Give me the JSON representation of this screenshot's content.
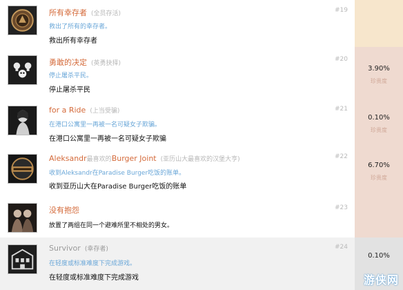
{
  "achievements": [
    {
      "icon": "survivor-medal-icon",
      "title": "所有幸存者",
      "tag": "(全员存活)",
      "desc_en": "救出了所有的幸存者。",
      "desc_cn": "救出所有幸存者",
      "number": "#19",
      "percent": "",
      "difficulty": ""
    },
    {
      "icon": "skulls-icon",
      "title": "勇敢的决定",
      "tag": "(英勇抉择)",
      "desc_en": "停止屠杀平民。",
      "desc_cn": "停止屠杀平民",
      "number": "#20",
      "percent": "3.90%",
      "difficulty": "珍贵度"
    },
    {
      "icon": "woman-portrait-icon",
      "title": "for a Ride",
      "tag": "(上当受骗)",
      "desc_en": "在港口公寓里一再被一名可疑女子欺骗。",
      "desc_cn": "在港口公寓里一再被一名可疑女子欺骗",
      "number": "#21",
      "percent": "0.10%",
      "difficulty": "珍贵度"
    },
    {
      "icon": "burger-joint-badge-icon",
      "title_parts": [
        "Aleksandr",
        "最喜欢的",
        "Burger Joint"
      ],
      "tag": "(亚历山大最喜欢的汉堡大亨)",
      "desc_en": "收到Aleksandr在Paradise Burger吃饭的账单。",
      "desc_cn": "收到亚历山大在Paradise Burger吃饭的账单",
      "number": "#22",
      "percent": "6.70%",
      "difficulty": "珍贵度"
    },
    {
      "icon": "couple-portrait-icon",
      "title": "没有抱怨",
      "tag": "",
      "desc_en": "放置了两组在同一个避难所里不相处的男女。",
      "desc_cn": "",
      "number": "#23",
      "percent": "",
      "difficulty": ""
    },
    {
      "icon": "building-icon",
      "title": "Survivor",
      "tag": "(幸存者)",
      "desc_en": "在轻度或标准难度下完成游戏。",
      "desc_cn": "在轻度或标准难度下完成游戏",
      "number": "#24",
      "percent": "0.10%",
      "difficulty": ""
    }
  ],
  "colors": {
    "row1_side": "#f7e6cc",
    "row_side_warm": "#efdad0",
    "row_side_gray": "#e2e2e2",
    "title_accent": "#d46a3a",
    "desc_link": "#6aa7d8"
  },
  "watermark": "游侠网"
}
